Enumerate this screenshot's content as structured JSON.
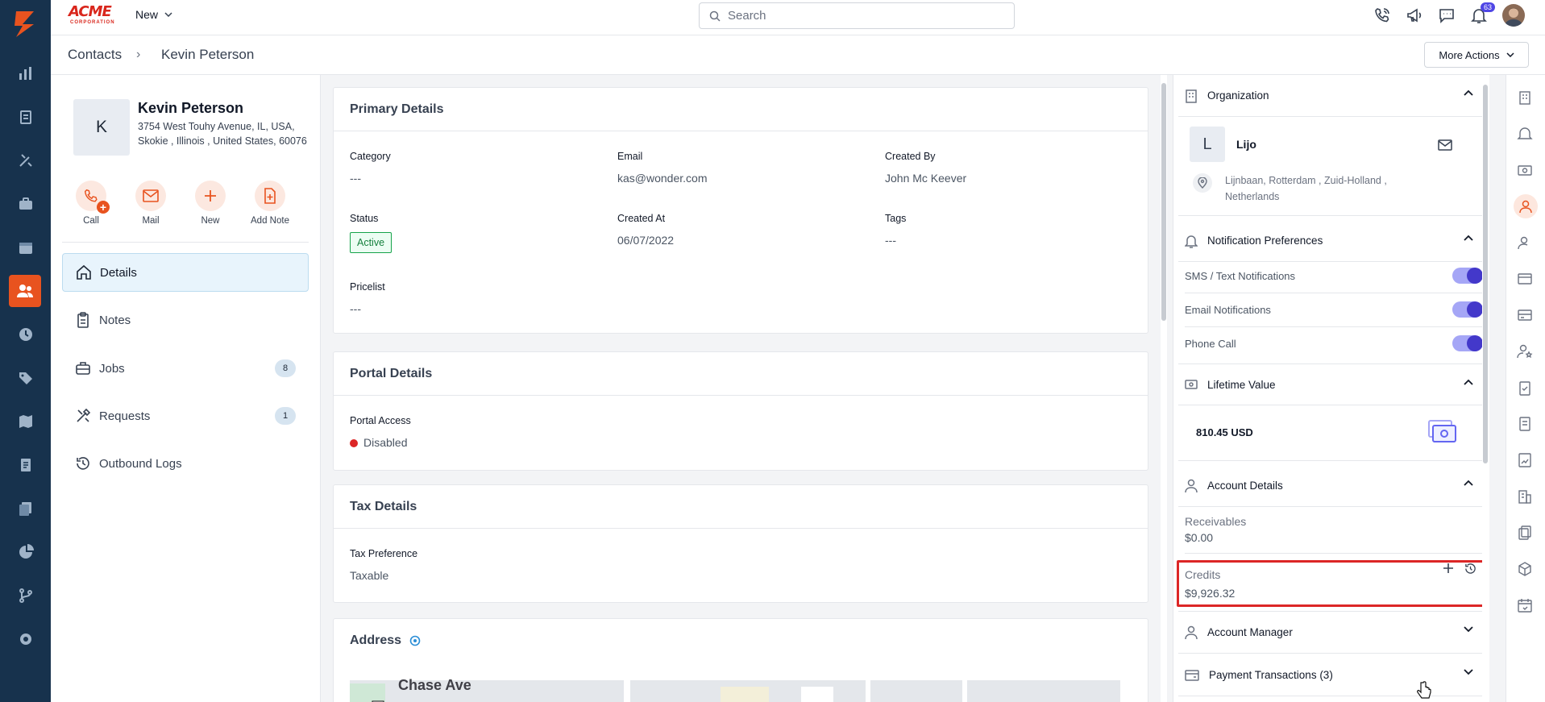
{
  "brand": {
    "name": "ACME",
    "sub": "CORPORATION"
  },
  "topbar": {
    "new_label": "New",
    "search_placeholder": "Search",
    "notification_count": "63"
  },
  "breadcrumb": {
    "root": "Contacts",
    "separator": "›",
    "current": "Kevin Peterson"
  },
  "more_actions_label": "More Actions",
  "contact": {
    "initial": "K",
    "name": "Kevin Peterson",
    "address_line1": "3754 West Touhy Avenue, IL, USA,",
    "address_line2": "Skokie , Illinois , United States, 60076"
  },
  "quick_actions": {
    "call": "Call",
    "mail": "Mail",
    "new": "New",
    "add_note": "Add Note"
  },
  "menu": {
    "details": "Details",
    "notes": "Notes",
    "jobs": "Jobs",
    "jobs_count": "8",
    "requests": "Requests",
    "requests_count": "1",
    "outbound_logs": "Outbound Logs"
  },
  "primary_details": {
    "title": "Primary Details",
    "category_label": "Category",
    "category_value": "---",
    "email_label": "Email",
    "email_value": "kas@wonder.com",
    "created_by_label": "Created By",
    "created_by_value": "John Mc Keever",
    "status_label": "Status",
    "status_value": "Active",
    "created_at_label": "Created At",
    "created_at_value": "06/07/2022",
    "tags_label": "Tags",
    "tags_value": "---",
    "pricelist_label": "Pricelist",
    "pricelist_value": "---"
  },
  "portal_details": {
    "title": "Portal Details",
    "access_label": "Portal Access",
    "access_value": "Disabled"
  },
  "tax_details": {
    "title": "Tax Details",
    "pref_label": "Tax Preference",
    "pref_value": "Taxable"
  },
  "address": {
    "title": "Address",
    "map_street": "Chase Ave"
  },
  "side": {
    "organization": {
      "title": "Organization",
      "initial": "L",
      "name": "Lijo",
      "address_line1": "Lijnbaan, Rotterdam , Zuid-Holland ,",
      "address_line2": "Netherlands"
    },
    "notifications": {
      "title": "Notification Preferences",
      "sms": "SMS / Text Notifications",
      "email": "Email Notifications",
      "phone": "Phone Call",
      "sms_on": true,
      "email_on": true,
      "phone_on": true
    },
    "lifetime": {
      "title": "Lifetime Value",
      "value": "810.45 USD"
    },
    "account": {
      "title": "Account Details",
      "receivables_label": "Receivables",
      "receivables_value": "$0.00",
      "credits_label": "Credits",
      "credits_value": "$9,926.32"
    },
    "account_manager": {
      "title": "Account Manager"
    },
    "payment_transactions": {
      "title": "Payment Transactions (3)"
    }
  },
  "colors": {
    "nav_bg": "#17324d",
    "accent": "#e8531f",
    "toggle": "#4338ca",
    "highlight": "#dc2626"
  }
}
